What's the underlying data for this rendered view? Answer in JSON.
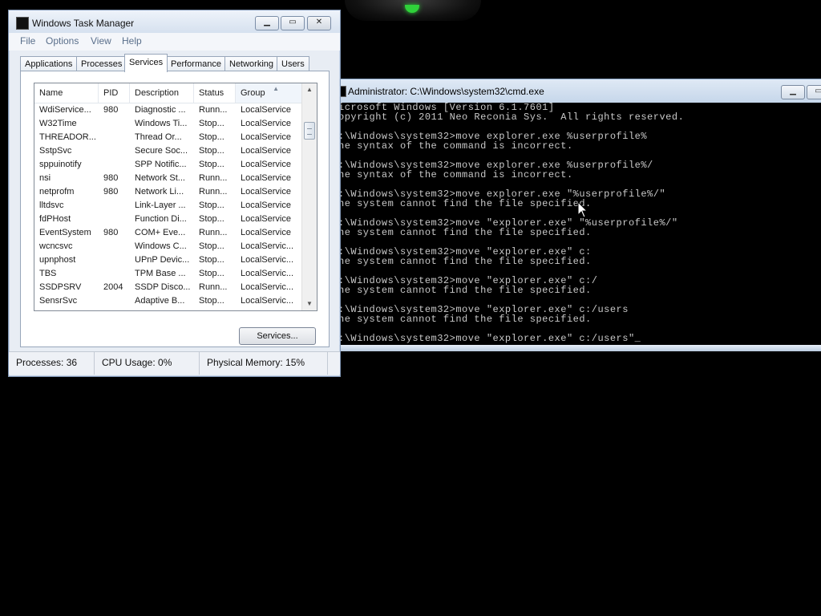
{
  "task_manager": {
    "title": "Windows Task Manager",
    "controls": {
      "minimize": "▁",
      "maximize": "▭",
      "close": "✕"
    },
    "menu": [
      "File",
      "Options",
      "View",
      "Help"
    ],
    "tabs": [
      "Applications",
      "Processes",
      "Services",
      "Performance",
      "Networking",
      "Users"
    ],
    "active_tab": "Services",
    "columns": [
      "Name",
      "PID",
      "Description",
      "Status",
      "Group"
    ],
    "sorted_column": "Group",
    "rows": [
      {
        "name": "WdiService...",
        "pid": "980",
        "description": "Diagnostic ...",
        "status": "Runn...",
        "group": "LocalService"
      },
      {
        "name": "W32Time",
        "pid": "",
        "description": "Windows Ti...",
        "status": "Stop...",
        "group": "LocalService"
      },
      {
        "name": "THREADOR...",
        "pid": "",
        "description": "Thread Or...",
        "status": "Stop...",
        "group": "LocalService"
      },
      {
        "name": "SstpSvc",
        "pid": "",
        "description": "Secure Soc...",
        "status": "Stop...",
        "group": "LocalService"
      },
      {
        "name": "sppuinotify",
        "pid": "",
        "description": "SPP Notific...",
        "status": "Stop...",
        "group": "LocalService"
      },
      {
        "name": "nsi",
        "pid": "980",
        "description": "Network St...",
        "status": "Runn...",
        "group": "LocalService"
      },
      {
        "name": "netprofm",
        "pid": "980",
        "description": "Network Li...",
        "status": "Runn...",
        "group": "LocalService"
      },
      {
        "name": "lltdsvc",
        "pid": "",
        "description": "Link-Layer ...",
        "status": "Stop...",
        "group": "LocalService"
      },
      {
        "name": "fdPHost",
        "pid": "",
        "description": "Function Di...",
        "status": "Stop...",
        "group": "LocalService"
      },
      {
        "name": "EventSystem",
        "pid": "980",
        "description": "COM+ Eve...",
        "status": "Runn...",
        "group": "LocalService"
      },
      {
        "name": "wcncsvc",
        "pid": "",
        "description": "Windows C...",
        "status": "Stop...",
        "group": "LocalServic..."
      },
      {
        "name": "upnphost",
        "pid": "",
        "description": "UPnP Devic...",
        "status": "Stop...",
        "group": "LocalServic..."
      },
      {
        "name": "TBS",
        "pid": "",
        "description": "TPM Base ...",
        "status": "Stop...",
        "group": "LocalServic..."
      },
      {
        "name": "SSDPSRV",
        "pid": "2004",
        "description": "SSDP Disco...",
        "status": "Runn...",
        "group": "LocalServic..."
      },
      {
        "name": "SensrSvc",
        "pid": "",
        "description": "Adaptive B...",
        "status": "Stop...",
        "group": "LocalServic..."
      }
    ],
    "services_button": "Services...",
    "status": {
      "processes": "Processes: 36",
      "cpu": "CPU Usage: 0%",
      "memory": "Physical Memory: 15%"
    }
  },
  "cmd": {
    "title": "Administrator: C:\\Windows\\system32\\cmd.exe",
    "controls": {
      "minimize": "▁",
      "maximize": "▭"
    },
    "lines": [
      "icrosoft Windows [Version 6.1.7601]",
      "opyright (c) 2011 Neo Reconia Sys.  All rights reserved.",
      "",
      ":\\Windows\\system32>move explorer.exe %userprofile%",
      "he syntax of the command is incorrect.",
      "",
      ":\\Windows\\system32>move explorer.exe %userprofile%/",
      "he syntax of the command is incorrect.",
      "",
      ":\\Windows\\system32>move explorer.exe \"%userprofile%/\"",
      "he system cannot find the file specified.",
      "",
      ":\\Windows\\system32>move \"explorer.exe\" \"%userprofile%/\"",
      "he system cannot find the file specified.",
      "",
      ":\\Windows\\system32>move \"explorer.exe\" c:",
      "he system cannot find the file specified.",
      "",
      ":\\Windows\\system32>move \"explorer.exe\" c:/",
      "he system cannot find the file specified.",
      "",
      ":\\Windows\\system32>move \"explorer.exe\" c:/users",
      "he system cannot find the file specified.",
      "",
      ":\\Windows\\system32>move \"explorer.exe\" c:/users\"_"
    ]
  }
}
